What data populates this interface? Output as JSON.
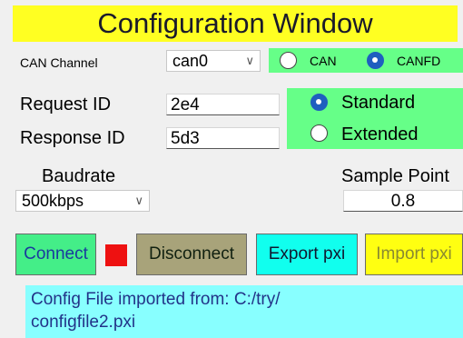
{
  "window": {
    "title": "Configuration Window"
  },
  "can_channel": {
    "label": "CAN Channel",
    "selected": "can0",
    "arrow_icon": "chevron-down-icon"
  },
  "protocol": {
    "options": [
      {
        "label": "CAN",
        "checked": false
      },
      {
        "label": "CANFD",
        "checked": true
      }
    ]
  },
  "ids": {
    "request_label": "Request ID",
    "request_value": "2e4",
    "response_label": "Response ID",
    "response_value": "5d3"
  },
  "id_format": {
    "options": [
      {
        "label": "Standard",
        "checked": true
      },
      {
        "label": "Extended",
        "checked": false
      }
    ]
  },
  "baudrate": {
    "label": "Baudrate",
    "selected": "500kbps"
  },
  "sample_point": {
    "label": "Sample Point",
    "value": "0.8"
  },
  "buttons": {
    "connect": "Connect",
    "disconnect": "Disconnect",
    "export": "Export pxi",
    "import": "Import pxi"
  },
  "colors": {
    "title_bg": "#ffff22",
    "green": "#66ff88",
    "connect": "#44ee88",
    "status_indicator": "#ee1111",
    "disconnect": "#a8a37a",
    "export": "#11ffee",
    "import": "#ffff11",
    "status_bg": "#88ffff"
  },
  "status": {
    "line1": "Config File imported from: C:/try/",
    "line2": "configfile2.pxi"
  }
}
